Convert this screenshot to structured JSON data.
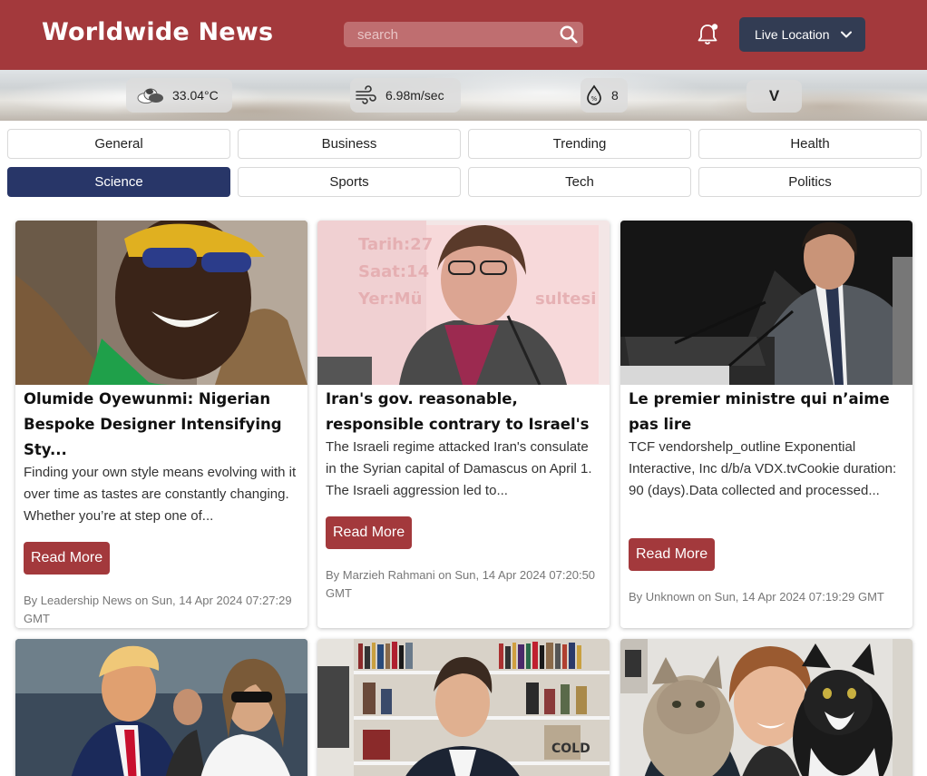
{
  "header": {
    "brand": "Worldwide News",
    "search_placeholder": "search",
    "live_location_label": "Live Location",
    "bg_color": "#a3393c"
  },
  "weather": {
    "temperature": "33.04°C",
    "wind": "6.98m/sec",
    "humidity": "8",
    "expand_label": "V"
  },
  "categories": [
    {
      "label": "General",
      "active": false
    },
    {
      "label": "Business",
      "active": false
    },
    {
      "label": "Trending",
      "active": false
    },
    {
      "label": "Health",
      "active": false
    },
    {
      "label": "Science",
      "active": true
    },
    {
      "label": "Sports",
      "active": false
    },
    {
      "label": "Tech",
      "active": false
    },
    {
      "label": "Politics",
      "active": false
    }
  ],
  "articles": [
    {
      "title": "Olumide Oyewunmi: Nigerian Bespoke Designer Intensifying Sty...",
      "description": "Finding your own style means evolving with it over time as tastes are constantly changing. Whether you’re at step one of...",
      "button": "Read More",
      "meta": "By Leadership News on Sun, 14 Apr 2024 07:27:29 GMT"
    },
    {
      "title": "Iran's gov. reasonable, responsible contrary to Israel's",
      "description": "The Israeli regime attacked Iran's consulate in the Syrian capital of Damascus on April 1. The Israeli aggression led to...",
      "button": "Read More",
      "meta": "By Marzieh Rahmani on Sun, 14 Apr 2024 07:20:50 GMT"
    },
    {
      "title": "Le premier ministre qui n’aime pas lire",
      "description": "TCF vendorshelp_outline Exponential Interactive, Inc d/b/a VDX.tvCookie duration: 90 (days).Data collected and processed...",
      "button": "Read More",
      "meta": "By Unknown on Sun, 14 Apr 2024 07:19:29 GMT"
    }
  ],
  "colors": {
    "accent": "#a3393c",
    "navy": "#323c53",
    "active_category": "#283668"
  }
}
